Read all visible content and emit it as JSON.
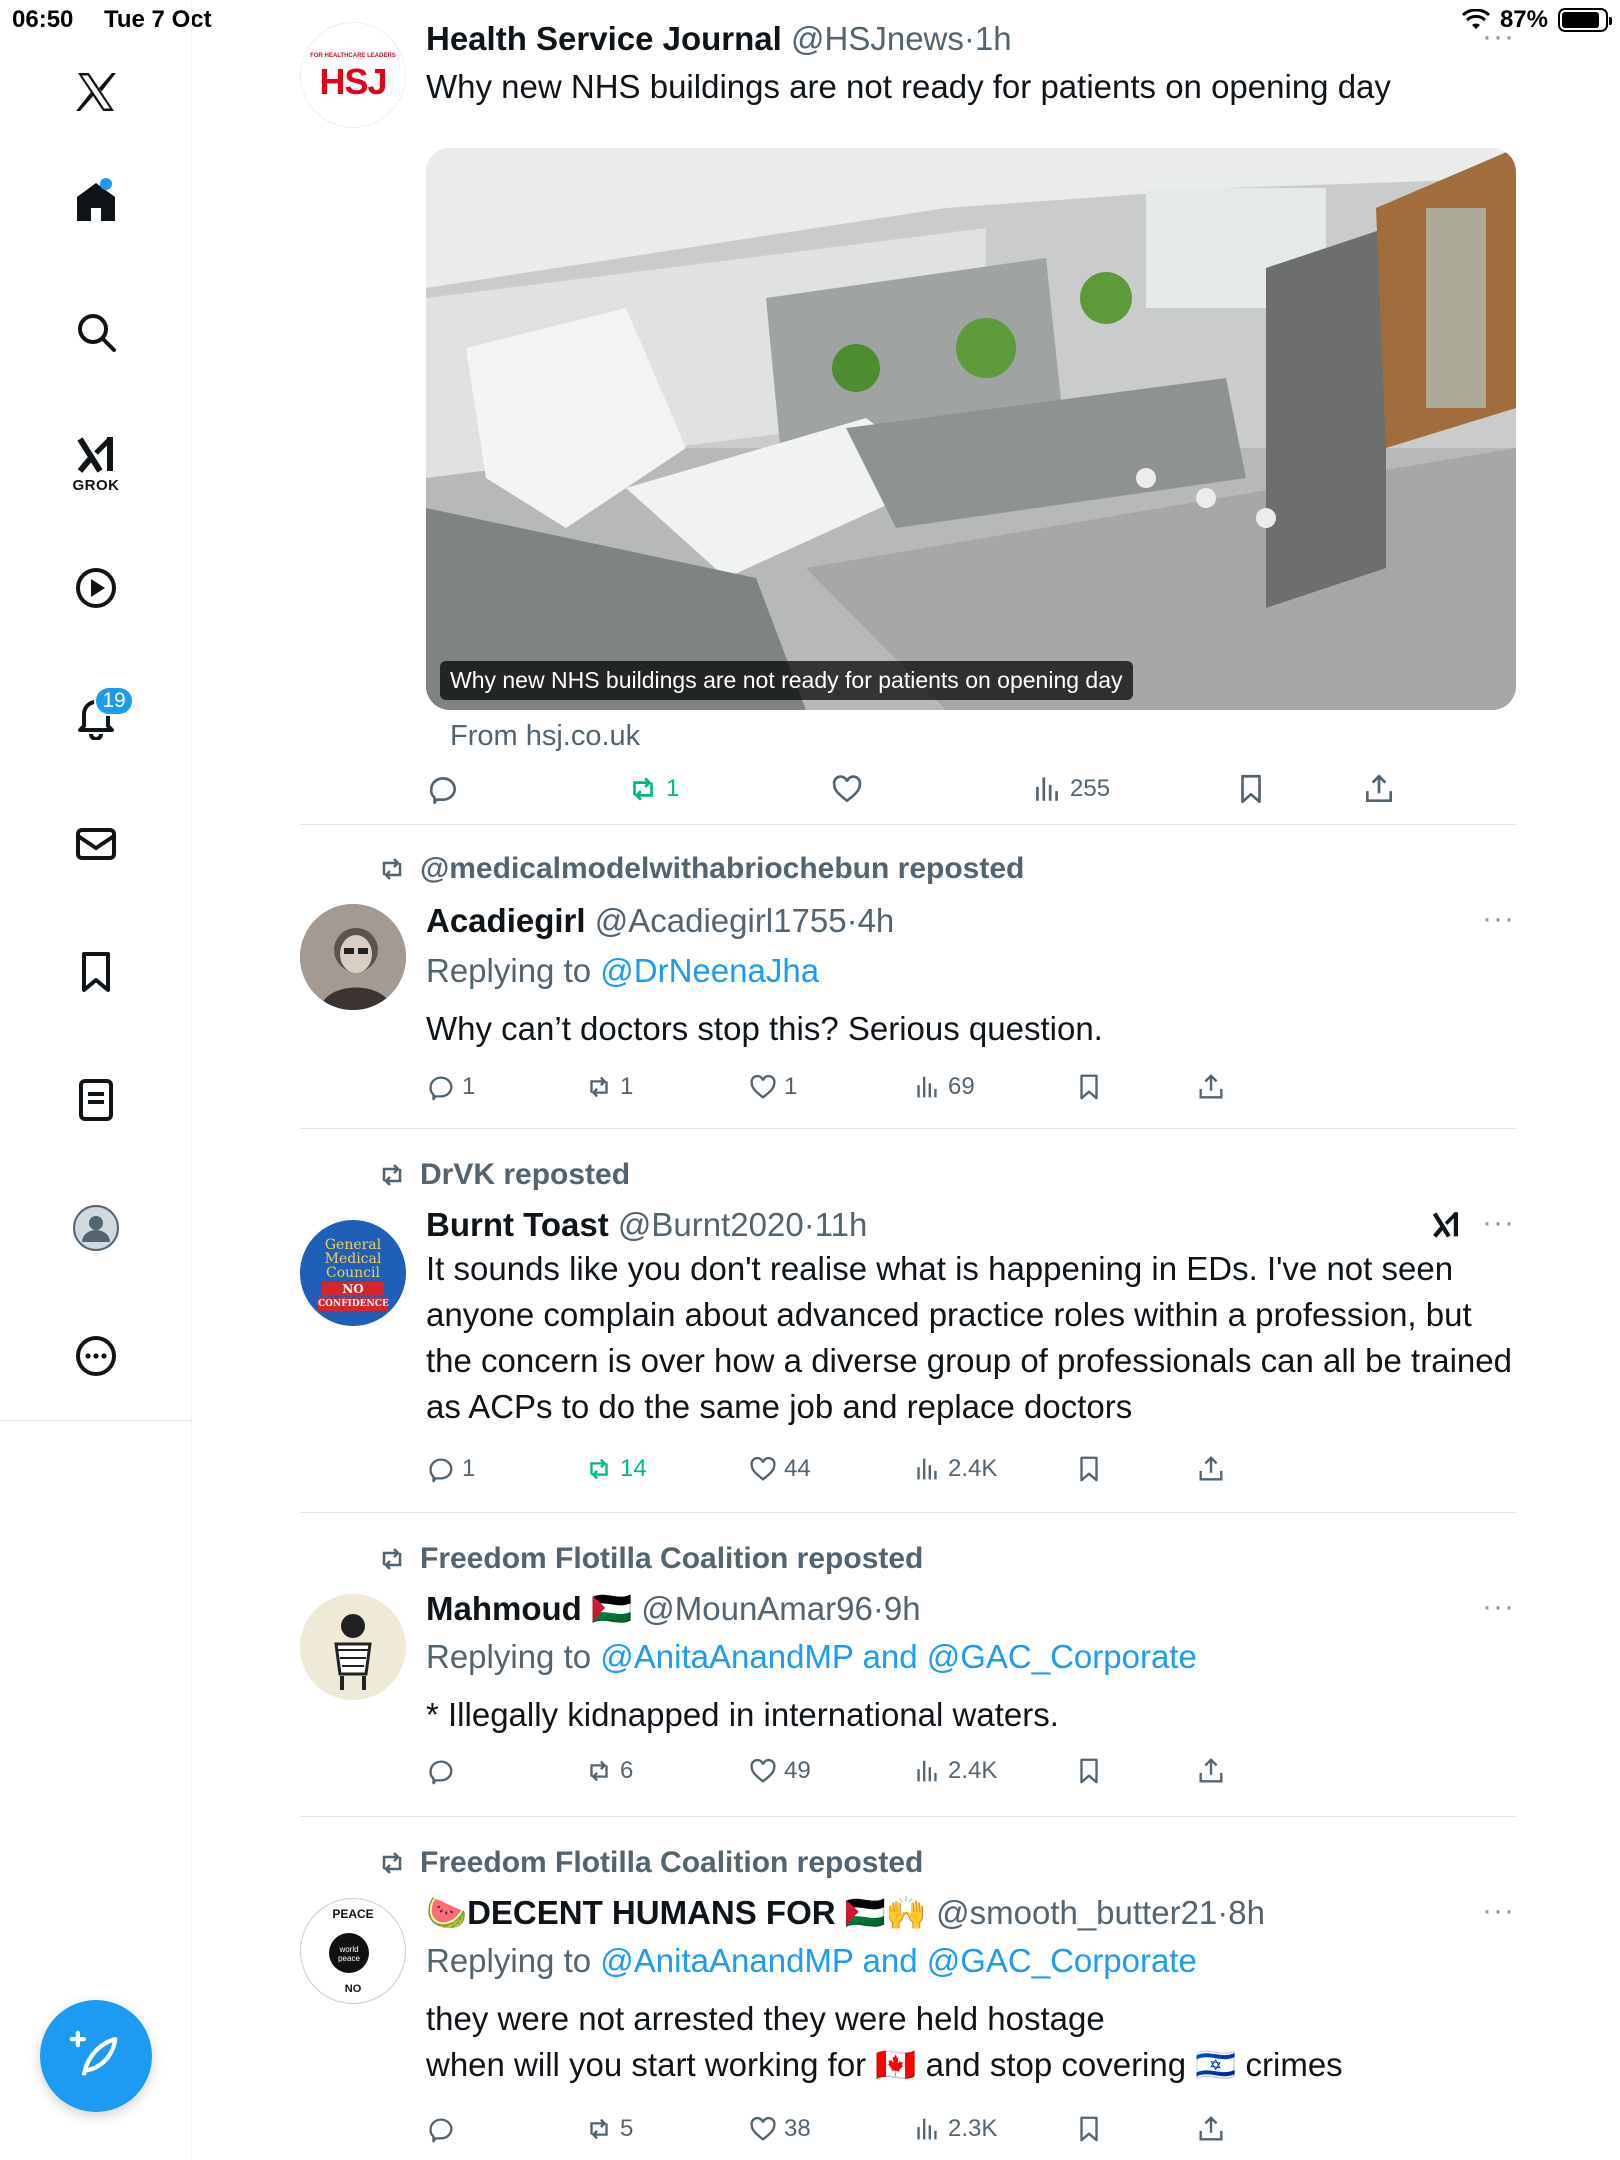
{
  "status": {
    "time": "06:50",
    "date": "Tue 7 Oct",
    "battery": "87%",
    "battery_level": 0.87
  },
  "sidebar": {
    "logo": "x-logo-icon",
    "items": [
      {
        "name": "home",
        "icon": "home-icon"
      },
      {
        "name": "search",
        "icon": "search-icon"
      },
      {
        "name": "grok",
        "icon": "grok-icon",
        "label": "GROK"
      },
      {
        "name": "video",
        "icon": "play-icon"
      },
      {
        "name": "notifications",
        "icon": "bell-icon",
        "badge": "19"
      },
      {
        "name": "messages",
        "icon": "mail-icon"
      },
      {
        "name": "bookmarks",
        "icon": "bookmark-icon"
      },
      {
        "name": "lists",
        "icon": "list-icon"
      },
      {
        "name": "profile",
        "icon": "avatar-icon"
      },
      {
        "name": "more",
        "icon": "more-icon"
      }
    ],
    "compose": "compose-icon"
  },
  "posts": [
    {
      "name": "Health Service Journal",
      "handle": "@HSJnews",
      "sep": "·",
      "time": "1h",
      "text": "Why new NHS buildings are not ready for patients on opening day",
      "avatar_text": "HSJ",
      "avatar_small": "FOR HEALTHCARE LEADERS",
      "card": {
        "caption": "Why new NHS buildings are not ready for patients on opening day",
        "source": "From hsj.co.uk"
      },
      "stats": {
        "replies": "",
        "reposts": "1",
        "likes": "",
        "views": "255"
      }
    },
    {
      "repost_by": "@medicalmodelwithabriochebun reposted",
      "name": "Acadiegirl",
      "handle": "@Acadiegirl1755",
      "sep": "·",
      "time": "4h",
      "reply_prefix": "Replying to",
      "reply_to": "@DrNeenaJha",
      "text": "Why can’t doctors stop this? Serious question.",
      "stats": {
        "replies": "1",
        "reposts": "1",
        "likes": "1",
        "views": "69"
      }
    },
    {
      "repost_by": "DrVK reposted",
      "name": "Burnt Toast",
      "handle": "@Burnt2020",
      "sep": "·",
      "time": "11h",
      "text": "It sounds like you don't realise what is happening in EDs. I've not seen anyone complain about advanced practice roles within a profession, but the concern is over how a diverse group of professionals can all be trained as ACPs to do the same job and replace doctors",
      "avatar_lines": [
        "General",
        "Medical",
        "Council",
        "NO",
        "CONFIDENCE"
      ],
      "stats": {
        "replies": "1",
        "reposts": "14",
        "likes": "44",
        "views": "2.4K"
      }
    },
    {
      "repost_by": "Freedom Flotilla Coalition reposted",
      "name": "Mahmoud 🇵🇸",
      "handle": "@MounAmar96",
      "sep": "·",
      "time": "9h",
      "reply_prefix": "Replying to",
      "reply_to": "@AnitaAnandMP and @GAC_Corporate",
      "text": "* Illegally kidnapped in international waters.",
      "stats": {
        "replies": "",
        "reposts": "6",
        "likes": "49",
        "views": "2.4K"
      }
    },
    {
      "repost_by": "Freedom Flotilla Coalition reposted",
      "name": "🍉DECENT HUMANS FOR 🇵🇸🙌",
      "handle": "@smooth_butter21",
      "sep": "·",
      "time": "8h",
      "reply_prefix": "Replying to",
      "reply_to": "@AnitaAnandMP and @GAC_Corporate",
      "text_line1": "they were not arrested they were held hostage",
      "text_line2": "when will you start working for 🇨🇦 and stop covering 🇮🇱 crimes",
      "avatar_lines": [
        "PEACE",
        "world peace",
        "NO"
      ],
      "stats": {
        "replies": "",
        "reposts": "5",
        "likes": "38",
        "views": "2.3K"
      }
    }
  ],
  "colors": {
    "accent": "#1d9bf0",
    "repost_green": "#00ba7c",
    "secondary_text": "#536471",
    "divider": "#dfe3e6"
  }
}
